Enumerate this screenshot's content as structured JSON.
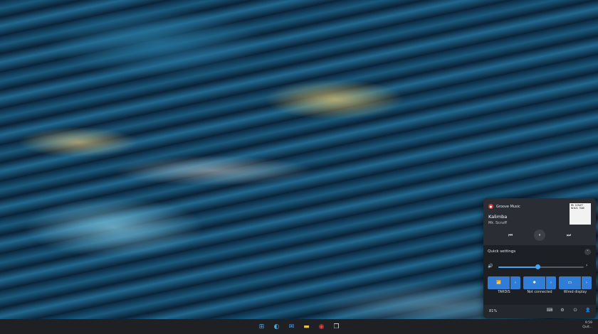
{
  "media": {
    "app_name": "Groove Music",
    "app_icon": "groove-music-icon",
    "title": "Kalimba",
    "artist": "Mr. Scruff",
    "album_art_text": "MR SCRUFF\nNINJA TUNE",
    "controls": {
      "previous": "⏮",
      "play_pause": "⏸",
      "next": "⏭"
    }
  },
  "quick_settings": {
    "header": "Quick settings",
    "collapse_icon": "˄",
    "volume": {
      "level": 0.46,
      "icon": "🔊",
      "more": "›"
    },
    "tiles": [
      {
        "icon": "wifi-icon",
        "glyph": "📶",
        "more": "›",
        "label": "TARDIS"
      },
      {
        "icon": "bluetooth-icon",
        "glyph": "✱",
        "more": "›",
        "label": "Not connected"
      },
      {
        "icon": "cast-icon",
        "glyph": "▭",
        "more": "›",
        "label": "Wired display"
      }
    ],
    "battery": "81%",
    "footer_icons": {
      "keyboard": "⌨",
      "settings": "⚙",
      "power": "⏻",
      "user": "👤"
    }
  },
  "taskbar": {
    "icons": [
      {
        "name": "start-icon",
        "glyph": "⊞",
        "color": "#4aa3ea"
      },
      {
        "name": "edge-icon",
        "glyph": "◐",
        "color": "#3fb0e6"
      },
      {
        "name": "mail-icon",
        "glyph": "✉",
        "color": "#5aa0e8"
      },
      {
        "name": "file-explorer-icon",
        "glyph": "▬",
        "color": "#f0c040"
      },
      {
        "name": "groove-music-icon",
        "glyph": "◉",
        "color": "#d04a4a"
      },
      {
        "name": "task-view-icon",
        "glyph": "❐",
        "color": "#dddddd"
      }
    ],
    "clock_time": "9:59",
    "clock_date": "Quit..."
  }
}
